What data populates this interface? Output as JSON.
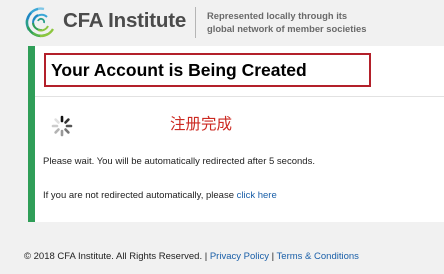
{
  "header": {
    "logo_text": "CFA Institute",
    "tagline_line1": "Represented locally through its",
    "tagline_line2": "global network of member societies"
  },
  "card": {
    "title": "Your Account is Being Created",
    "annotation": "注册完成",
    "wait_message": "Please wait. You will be automatically redirected after 5 seconds.",
    "fallback_message": "If you are not redirected automatically, please",
    "fallback_link": "click here"
  },
  "footer": {
    "copyright": "© 2018 CFA Institute. All Rights Reserved.",
    "separator1": " | ",
    "privacy_link": "Privacy Policy",
    "separator2": " | ",
    "terms_link": "Terms & Conditions"
  },
  "colors": {
    "accent_green": "#2f9e58",
    "highlight_red": "#b3202a",
    "link_blue": "#1a5fa8"
  },
  "icons": {
    "logo": "cfa-globe-logo-icon",
    "loading": "loading-spinner-icon"
  }
}
